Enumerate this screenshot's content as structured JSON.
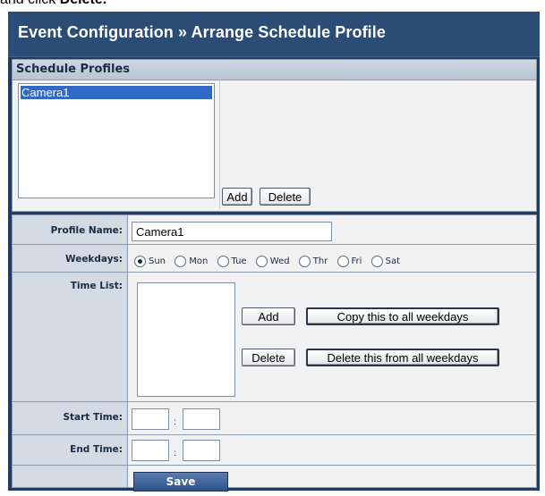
{
  "caption": {
    "prefix": "and click ",
    "action": "Delete."
  },
  "title": "Event Configuration » Arrange Schedule Profile",
  "schedule_profiles": {
    "header": "Schedule Profiles",
    "items": [
      "Camera1"
    ],
    "add_label": "Add",
    "delete_label": "Delete"
  },
  "form": {
    "profile_name_label": "Profile Name:",
    "profile_name_value": "Camera1",
    "weekdays_label": "Weekdays:",
    "weekdays": [
      {
        "label": "Sun",
        "selected": true
      },
      {
        "label": "Mon",
        "selected": false
      },
      {
        "label": "Tue",
        "selected": false
      },
      {
        "label": "Wed",
        "selected": false
      },
      {
        "label": "Thr",
        "selected": false
      },
      {
        "label": "Fri",
        "selected": false
      },
      {
        "label": "Sat",
        "selected": false
      }
    ],
    "time_list_label": "Time List:",
    "add_label": "Add",
    "copy_label": "Copy this to all weekdays",
    "delete_label": "Delete",
    "delete_all_label": "Delete this from all weekdays",
    "start_time_label": "Start Time:",
    "end_time_label": "End Time:",
    "time_separator": ":",
    "save_label": "Save"
  },
  "colors": {
    "title_bar": "#2b4c74",
    "frame": "#1f3d63",
    "selected_item": "#3169c6",
    "label_column": "#d3dae3",
    "save_button": "#2e5287"
  }
}
